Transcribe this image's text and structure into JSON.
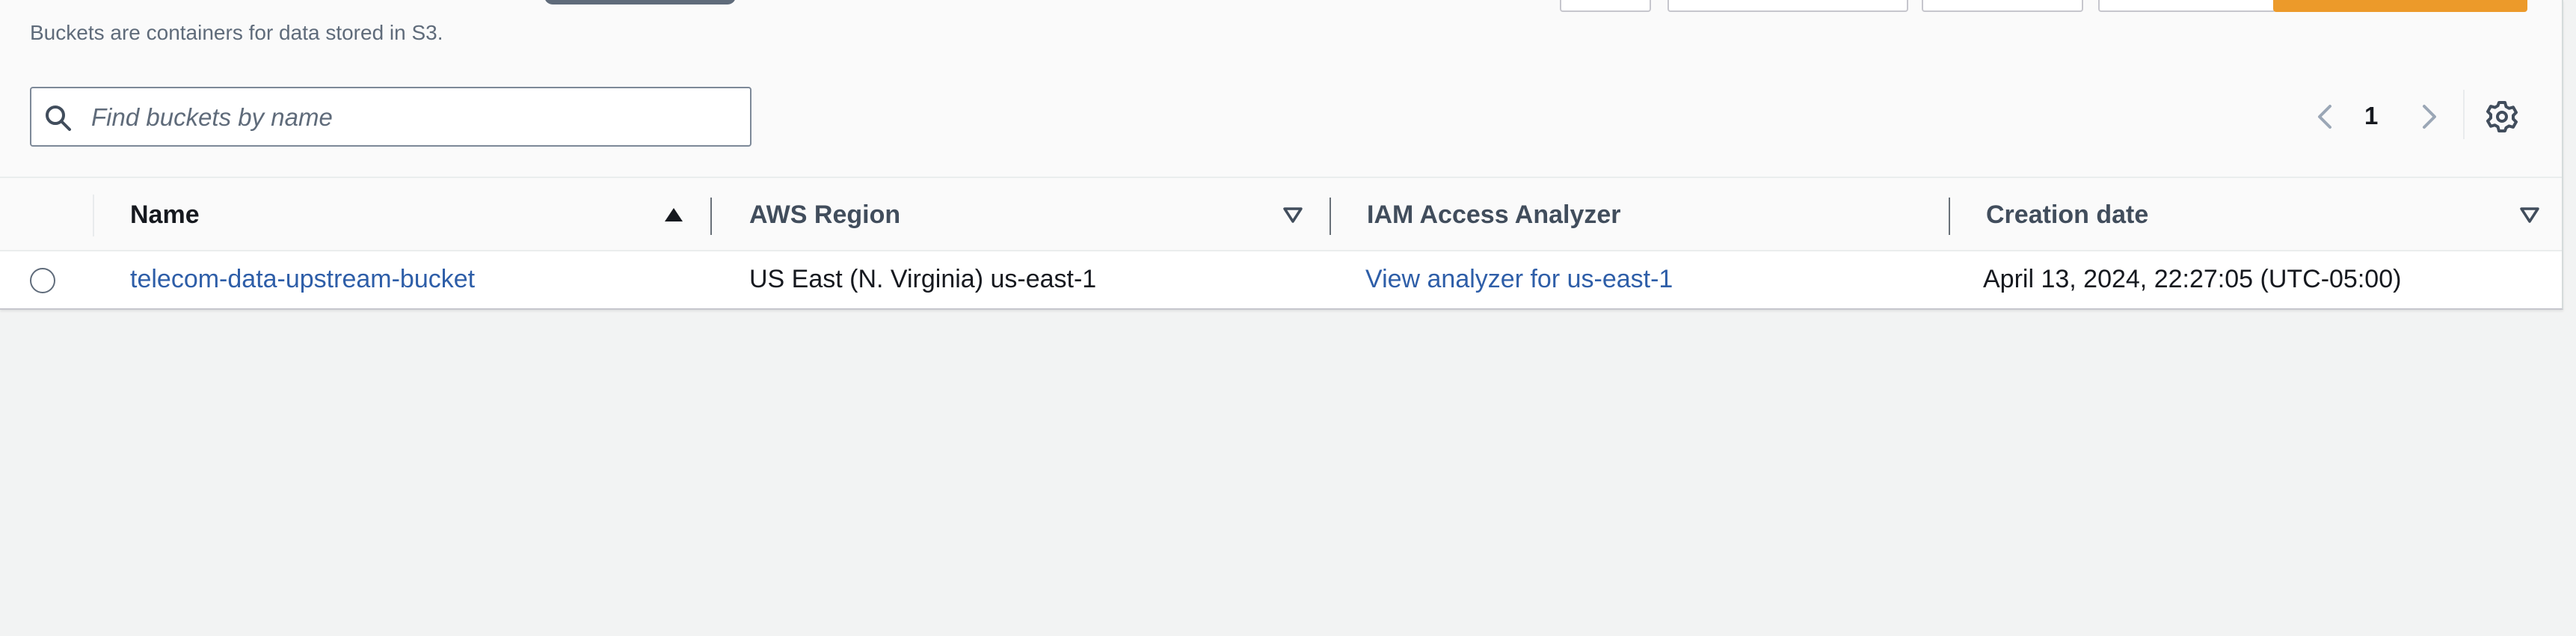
{
  "header": {
    "description": "Buckets are containers for data stored in S3."
  },
  "search": {
    "placeholder": "Find buckets by name",
    "value": ""
  },
  "pagination": {
    "current_page": "1"
  },
  "table": {
    "columns": [
      {
        "label": "Name",
        "sort": "ascending"
      },
      {
        "label": "AWS Region",
        "sort": "sortable"
      },
      {
        "label": "IAM Access Analyzer",
        "sort": "none"
      },
      {
        "label": "Creation date",
        "sort": "sortable"
      }
    ],
    "rows": [
      {
        "name": "telecom-data-upstream-bucket",
        "region": "US East (N. Virginia) us-east-1",
        "analyzer_link": "View analyzer for us-east-1",
        "creation_date": "April 13, 2024, 22:27:05 (UTC-05:00)",
        "selected": false
      }
    ]
  },
  "colors": {
    "link": "#2e5ea8",
    "primary_button": "#ec9a2a",
    "header_text": "#16191f",
    "muted_text": "#5f6b7a"
  },
  "icons": {
    "search": "search-icon",
    "prev": "chevron-left-icon",
    "next": "chevron-right-icon",
    "settings": "gear-icon",
    "sort_asc": "caret-up-filled-icon",
    "sort_desc": "caret-down-outline-icon"
  }
}
